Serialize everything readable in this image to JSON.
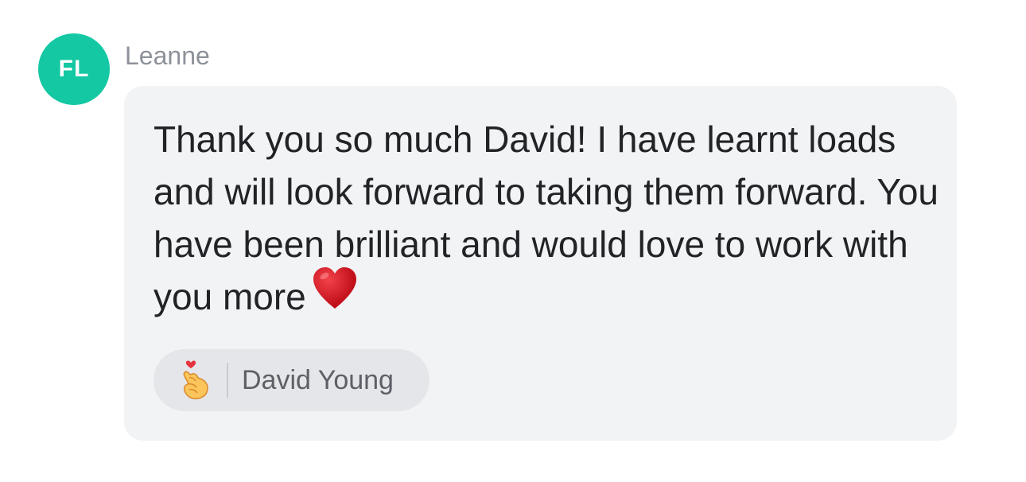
{
  "message": {
    "avatar_initials": "FL",
    "avatar_color": "#14c8a4",
    "sender_name": "Leanne",
    "text": "Thank you so much David! I have learnt loads and will look forward to taking them forward. You have been brilliant and would love to work with you more",
    "trailing_icon": "red-heart-icon",
    "bubble_color": "#f2f3f5"
  },
  "reaction": {
    "icon": "finger-heart-icon",
    "reactor_name": "David Young"
  }
}
